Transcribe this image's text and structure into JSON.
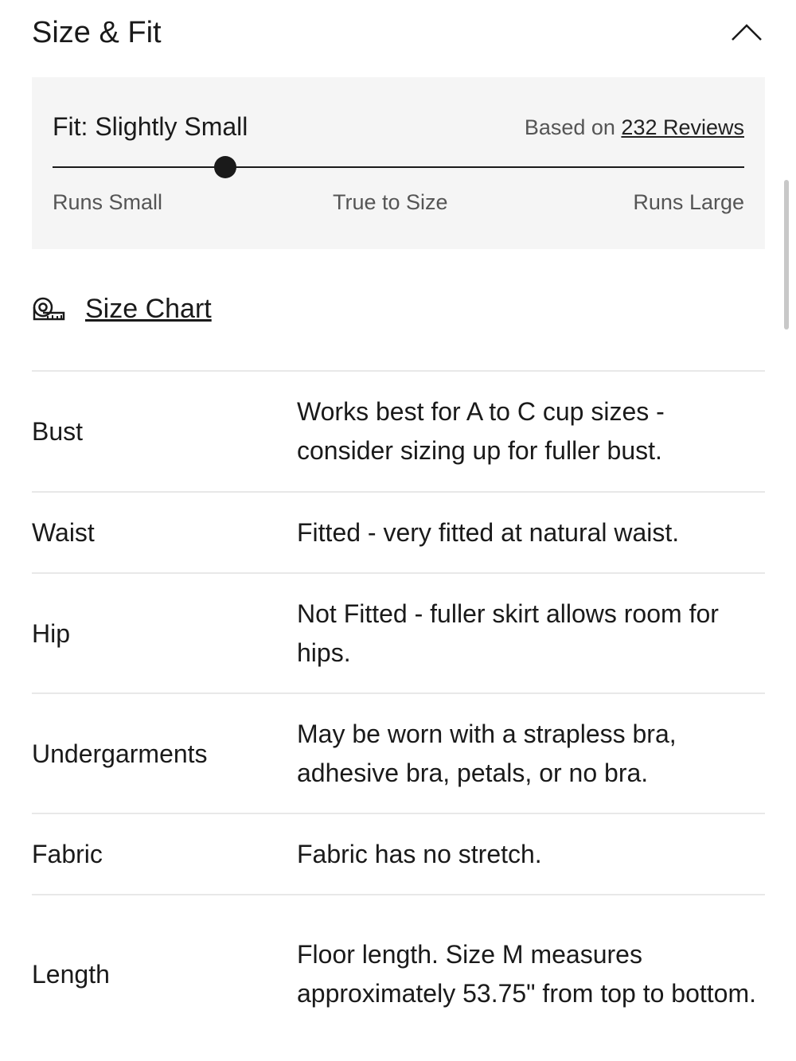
{
  "header": {
    "title": "Size & Fit",
    "toggle_icon": "chevron-up-icon"
  },
  "fit": {
    "title": "Fit: Slightly Small",
    "based_on": "Based on",
    "reviews_link": "232 Reviews",
    "scale_position": 0.25,
    "scale_labels": {
      "left": "Runs Small",
      "center": "True to Size",
      "right": "Runs Large"
    }
  },
  "size_chart": {
    "icon": "measuring-tape-icon",
    "label": "Size Chart"
  },
  "details": [
    {
      "label": "Bust",
      "value": "Works best for A to C cup sizes - consider sizing up for fuller bust."
    },
    {
      "label": "Waist",
      "value": "Fitted - very fitted at natural waist."
    },
    {
      "label": "Hip",
      "value": "Not Fitted - fuller skirt allows room for hips."
    },
    {
      "label": "Undergarments",
      "value": "May be worn with a strapless bra, adhesive bra, petals, or no bra."
    },
    {
      "label": "Fabric",
      "value": "Fabric has no stretch."
    },
    {
      "label": "Length",
      "value": "Floor length. Size M measures approximately 53.75\" from top to bottom."
    }
  ]
}
